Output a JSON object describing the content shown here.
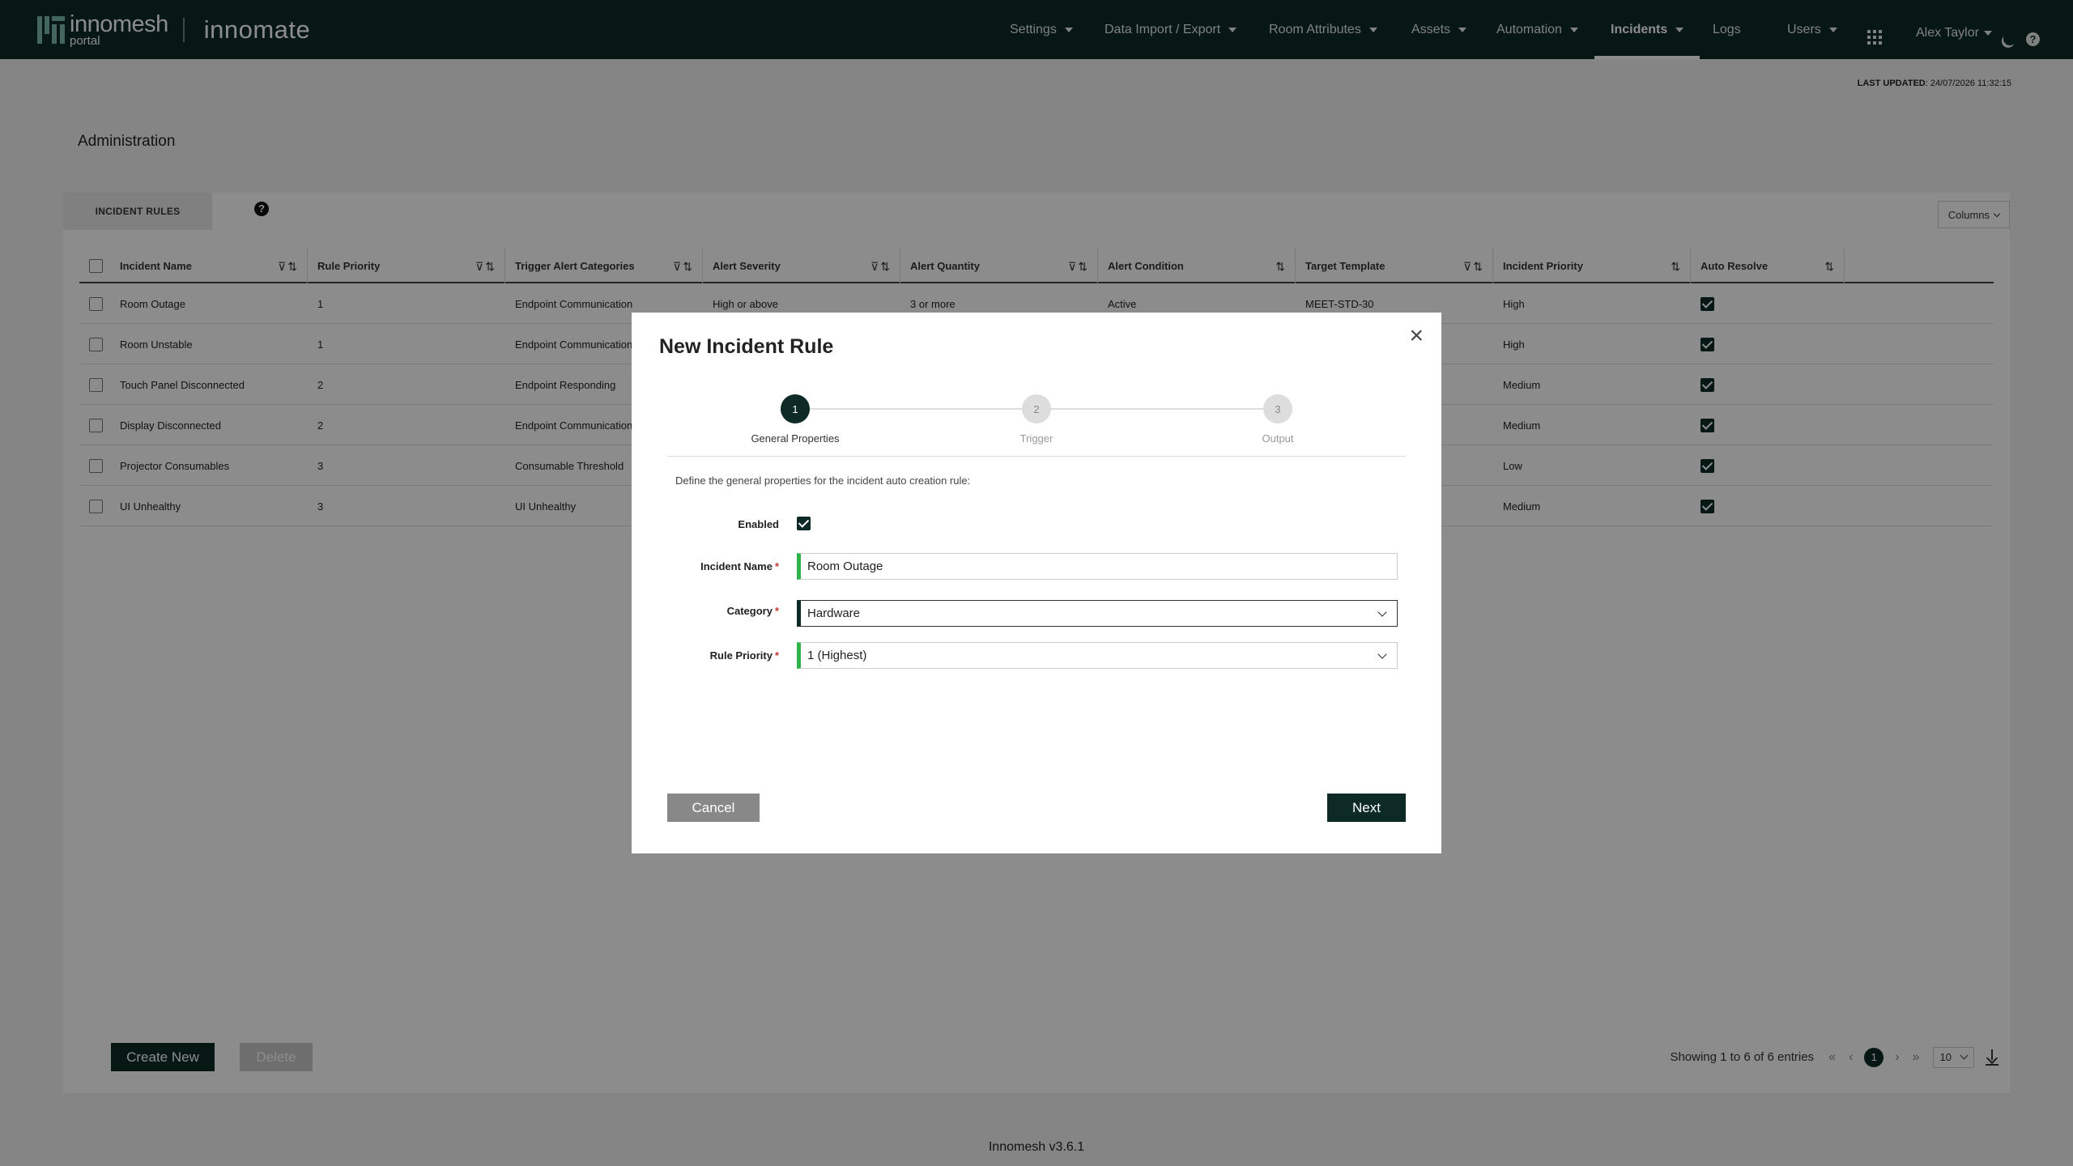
{
  "brand": {
    "name": "innomesh",
    "sub": "portal",
    "product": "innomate"
  },
  "nav": {
    "items": [
      {
        "label": "Settings",
        "caret": true
      },
      {
        "label": "Data Import / Export",
        "caret": true
      },
      {
        "label": "Room Attributes",
        "caret": true
      },
      {
        "label": "Assets",
        "caret": true
      },
      {
        "label": "Automation",
        "caret": true
      },
      {
        "label": "Incidents",
        "caret": true,
        "active": true
      },
      {
        "label": "Logs",
        "caret": false
      },
      {
        "label": "Users",
        "caret": true
      }
    ],
    "user": "Alex Taylor"
  },
  "status": {
    "last_updated_label": "LAST UPDATED",
    "last_updated_value": "24/07/2026 11:32:15"
  },
  "page": {
    "title": "Administration",
    "tab": "INCIDENT RULES",
    "columns_button": "Columns"
  },
  "table": {
    "headers": [
      "Incident Name",
      "Rule Priority",
      "Trigger Alert Categories",
      "Alert Severity",
      "Alert Quantity",
      "Alert Condition",
      "Target Template",
      "Incident Priority",
      "Auto Resolve"
    ],
    "rows": [
      {
        "name": "Room Outage",
        "priority": "1",
        "category": "Endpoint Communication",
        "severity": "High or above",
        "quantity": "3 or more",
        "condition": "Active",
        "template": "MEET-STD-30",
        "incident_priority": "High",
        "auto_resolve": true
      },
      {
        "name": "Room Unstable",
        "priority": "1",
        "category": "Endpoint Communication",
        "severity": "",
        "quantity": "",
        "condition": "",
        "template": "",
        "incident_priority": "High",
        "auto_resolve": true
      },
      {
        "name": "Touch Panel Disconnected",
        "priority": "2",
        "category": "Endpoint Responding",
        "severity": "",
        "quantity": "",
        "condition": "",
        "template": "",
        "incident_priority": "Medium",
        "auto_resolve": true
      },
      {
        "name": "Display Disconnected",
        "priority": "2",
        "category": "Endpoint Communication",
        "severity": "",
        "quantity": "",
        "condition": "",
        "template": "",
        "incident_priority": "Medium",
        "auto_resolve": true
      },
      {
        "name": "Projector Consumables",
        "priority": "3",
        "category": "Consumable Threshold",
        "severity": "",
        "quantity": "",
        "condition": "",
        "template": "",
        "incident_priority": "Low",
        "auto_resolve": true
      },
      {
        "name": "UI Unhealthy",
        "priority": "3",
        "category": "UI Unhealthy",
        "severity": "",
        "quantity": "",
        "condition": "",
        "template": "",
        "incident_priority": "Medium",
        "auto_resolve": true
      }
    ]
  },
  "actions": {
    "create": "Create New",
    "delete": "Delete"
  },
  "pagination": {
    "summary": "Showing 1 to 6 of 6 entries",
    "current_page": "1",
    "page_size": "10"
  },
  "footer": {
    "version": "Innomesh v3.6.1"
  },
  "modal": {
    "title": "New Incident Rule",
    "steps": [
      {
        "num": "1",
        "label": "General Properties"
      },
      {
        "num": "2",
        "label": "Trigger"
      },
      {
        "num": "3",
        "label": "Output"
      }
    ],
    "description": "Define the general properties for the incident auto creation rule:",
    "fields": {
      "enabled_label": "Enabled",
      "name_label": "Incident Name",
      "name_value": "Room Outage",
      "category_label": "Category",
      "category_value": "Hardware",
      "priority_label": "Rule Priority",
      "priority_value": "1 (Highest)"
    },
    "cancel": "Cancel",
    "next": "Next"
  },
  "colors": {
    "primary": "#0d2a26",
    "valid": "#2db34a",
    "required": "#c0392b"
  }
}
